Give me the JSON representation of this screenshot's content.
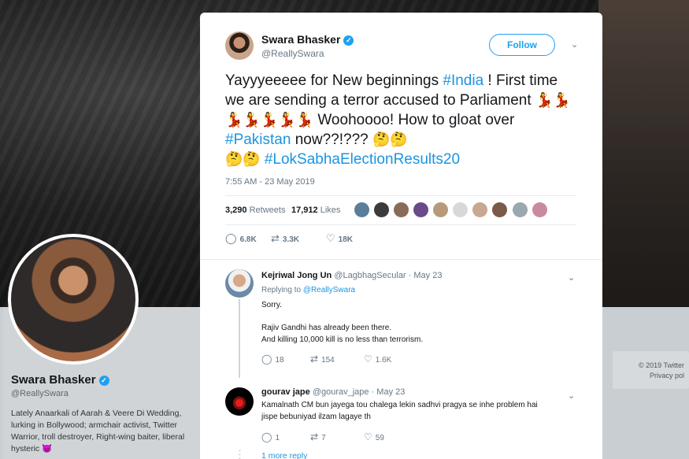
{
  "background": {
    "profile_name": "Swara Bhasker",
    "profile_handle": "@ReallySwara",
    "profile_bio": "Lately Anaarkali of Aarah & Veere Di Wedding, lurking in Bollywood; armchair activist, Twitter Warrior, troll destroyer, Right-wing baiter, liberal hysteric 😈",
    "footer_line1": "© 2019 Twitter",
    "footer_line2": "Privacy pol"
  },
  "tweet": {
    "author_name": "Swara Bhasker",
    "author_handle": "@ReallySwara",
    "follow_label": "Follow",
    "text_1": "Yayyyeeeee for New beginnings ",
    "tag_india": "#India",
    "text_2": " ! First time we are sending a terror accused to Parliament ",
    "dancers": "💃💃💃💃💃💃💃",
    "text_3": " Woohoooo! How to gloat over ",
    "tag_pakistan": "#Pakistan",
    "text_4": " now??!??? ",
    "thinking": "🤔🤔",
    "thinking2": "🤔🤔 ",
    "tag_results": "#LokSabhaElectionResults20",
    "timestamp": "7:55 AM - 23 May 2019",
    "retweets_count": "3,290",
    "retweets_label": "Retweets",
    "likes_count": "17,912",
    "likes_label": "Likes",
    "reply_count": "6.8K",
    "retweet_count": "3.3K",
    "like_count": "18K"
  },
  "replies": [
    {
      "name": "Kejriwal Jong Un",
      "meta": "@LagbhagSecular · May 23",
      "replying_prefix": "Replying to ",
      "replying_to": "@ReallySwara",
      "line1": "Sorry.",
      "line2": "Rajiv Gandhi has already been there.",
      "line3": "And killing 10,000 kill is no less than terrorism.",
      "replies": "18",
      "retweets": "154",
      "likes": "1.6K"
    },
    {
      "name": "gourav jape",
      "meta": "@gourav_jape · May 23",
      "line1": "Kamalnath CM bun jayega tou chalega lekin sadhvi pragya se inhe problem hai",
      "line2": "jispe bebuniyad ilzam lagaye th",
      "replies": "1",
      "retweets": "7",
      "likes": "59"
    }
  ],
  "more_reply": "1 more reply",
  "colors": {
    "accent": "#1da1f2",
    "link": "#1b95e0"
  }
}
